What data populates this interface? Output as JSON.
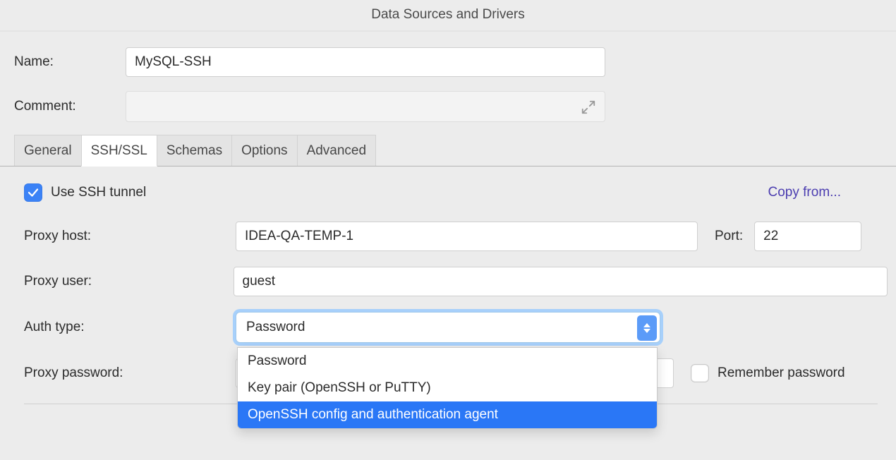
{
  "title": "Data Sources and Drivers",
  "labels": {
    "name": "Name:",
    "comment": "Comment:",
    "use_ssh": "Use SSH tunnel",
    "copy_from": "Copy from...",
    "proxy_host": "Proxy host:",
    "port": "Port:",
    "proxy_user": "Proxy user:",
    "auth_type": "Auth type:",
    "proxy_password": "Proxy password:",
    "remember": "Remember password"
  },
  "tabs": [
    "General",
    "SSH/SSL",
    "Schemas",
    "Options",
    "Advanced"
  ],
  "fields": {
    "name": "MySQL-SSH",
    "comment": "",
    "proxy_host": "IDEA-QA-TEMP-1",
    "port": "22",
    "proxy_user": "guest",
    "auth_type_selected": "Password",
    "proxy_password": ""
  },
  "auth_options": [
    "Password",
    "Key pair (OpenSSH or PuTTY)",
    "OpenSSH config and authentication agent"
  ],
  "state": {
    "use_ssh": true,
    "remember_password": false,
    "dropdown_open": true,
    "highlighted_index": 2,
    "active_tab": 1
  }
}
